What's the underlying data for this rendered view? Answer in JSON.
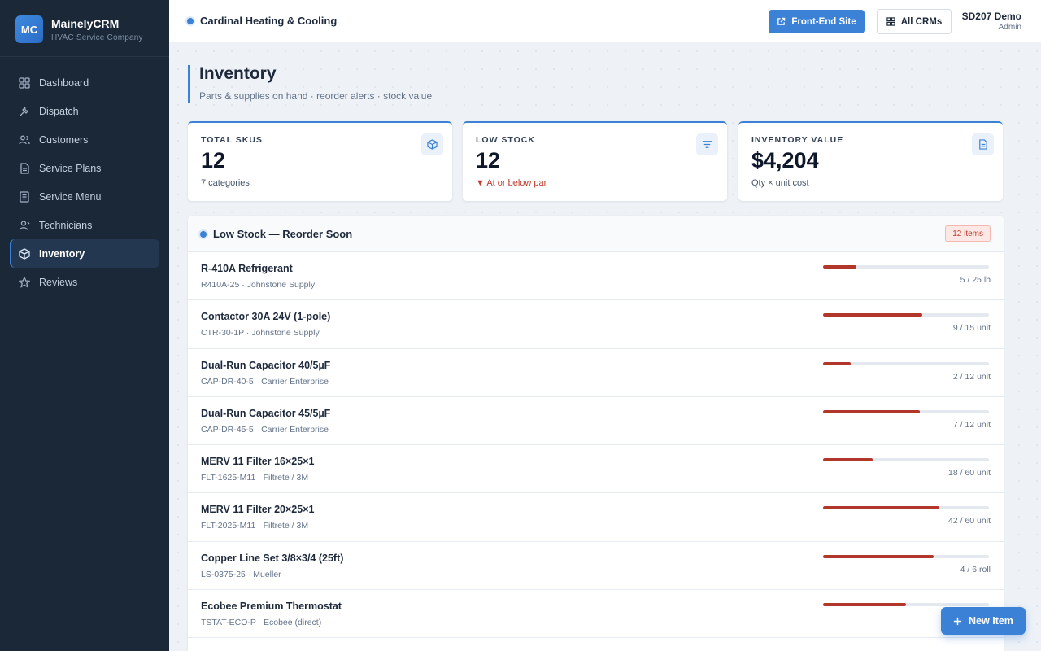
{
  "brand": {
    "logo": "MC",
    "name": "MainelyCRM",
    "subtitle": "HVAC Service Company"
  },
  "nav": [
    {
      "label": "Dashboard",
      "icon": "grid-icon",
      "active": false
    },
    {
      "label": "Dispatch",
      "icon": "wrench-icon",
      "active": false
    },
    {
      "label": "Customers",
      "icon": "users-icon",
      "active": false
    },
    {
      "label": "Service Plans",
      "icon": "document-icon",
      "active": false
    },
    {
      "label": "Service Menu",
      "icon": "list-icon",
      "active": false
    },
    {
      "label": "Technicians",
      "icon": "technician-icon",
      "active": false
    },
    {
      "label": "Inventory",
      "icon": "box-icon",
      "active": true
    },
    {
      "label": "Reviews",
      "icon": "star-icon",
      "active": false
    }
  ],
  "topbar": {
    "company": "Cardinal Heating & Cooling",
    "frontend_button": "Front-End Site",
    "all_crms_button": "All CRMs",
    "user_name": "SD207 Demo",
    "user_role": "Admin"
  },
  "page": {
    "title": "Inventory",
    "subtitle": "Parts & supplies on hand · reorder alerts · stock value"
  },
  "stats": [
    {
      "label": "TOTAL SKUS",
      "value": "12",
      "foot": "7 categories",
      "icon": "box-icon"
    },
    {
      "label": "LOW STOCK",
      "value": "12",
      "foot": "▼ At or below par",
      "icon": "filter-icon"
    },
    {
      "label": "INVENTORY VALUE",
      "value": "$4,204",
      "foot": "Qty × unit cost",
      "icon": "document-icon"
    }
  ],
  "low_stock": {
    "title": "Low Stock — Reorder Soon",
    "badge": "12 items",
    "items": [
      {
        "name": "R-410A Refrigerant",
        "meta": "R410A-25 · Johnstone Supply",
        "qty": "5 / 25 lb",
        "fill": 0.2
      },
      {
        "name": "Contactor 30A 24V (1-pole)",
        "meta": "CTR-30-1P · Johnstone Supply",
        "qty": "9 / 15 unit",
        "fill": 0.6
      },
      {
        "name": "Dual-Run Capacitor 40/5µF",
        "meta": "CAP-DR-40-5 · Carrier Enterprise",
        "qty": "2 / 12 unit",
        "fill": 0.1667
      },
      {
        "name": "Dual-Run Capacitor 45/5µF",
        "meta": "CAP-DR-45-5 · Carrier Enterprise",
        "qty": "7 / 12 unit",
        "fill": 0.5833
      },
      {
        "name": "MERV 11 Filter 16×25×1",
        "meta": "FLT-1625-M11 · Filtrete / 3M",
        "qty": "18 / 60 unit",
        "fill": 0.3
      },
      {
        "name": "MERV 11 Filter 20×25×1",
        "meta": "FLT-2025-M11 · Filtrete / 3M",
        "qty": "42 / 60 unit",
        "fill": 0.7
      },
      {
        "name": "Copper Line Set 3/8×3/4 (25ft)",
        "meta": "LS-0375-25 · Mueller",
        "qty": "4 / 6 roll",
        "fill": 0.6667
      },
      {
        "name": "Ecobee Premium Thermostat",
        "meta": "TSTAT-ECO-P · Ecobee (direct)",
        "qty": "",
        "fill": 0.5
      }
    ]
  },
  "fab": {
    "label": "New Item"
  },
  "colors": {
    "accent": "#3b82d6",
    "sidebar": "#1b2838",
    "danger": "#b3362b"
  }
}
